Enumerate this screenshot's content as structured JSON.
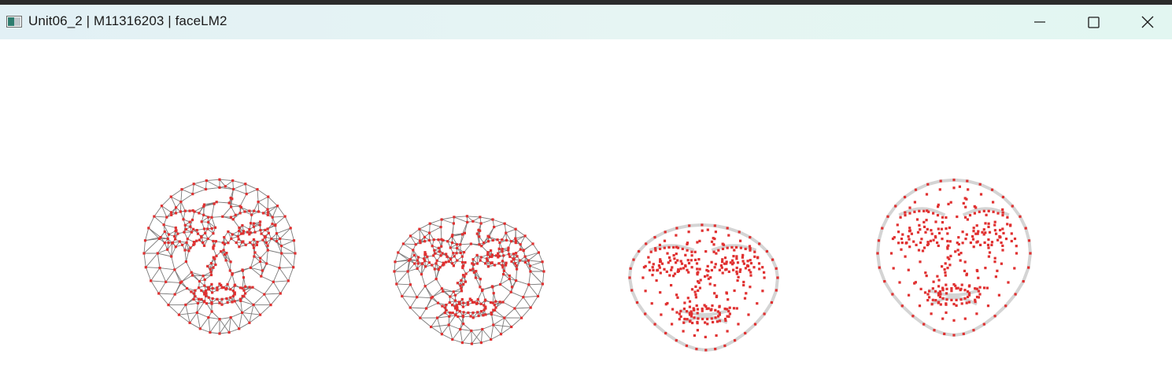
{
  "window": {
    "title": "Unit06_2 | M11316203 | faceLM2",
    "icons": {
      "app": "opencv-window-icon",
      "minimize": "minimize-icon",
      "maximize": "maximize-icon",
      "close": "close-icon"
    }
  },
  "canvas": {
    "panels": [
      {
        "name": "mesh-view-front",
        "style": "wireframe"
      },
      {
        "name": "mesh-view-tilted",
        "style": "wireframe"
      },
      {
        "name": "landmarks-view-tilted",
        "style": "points"
      },
      {
        "name": "landmarks-view-front",
        "style": "points"
      }
    ],
    "colors": {
      "mesh_edge": "#7a7a7a",
      "landmark": "#e03030",
      "contour": "#d4d4d4",
      "background": "#ffffff"
    }
  }
}
